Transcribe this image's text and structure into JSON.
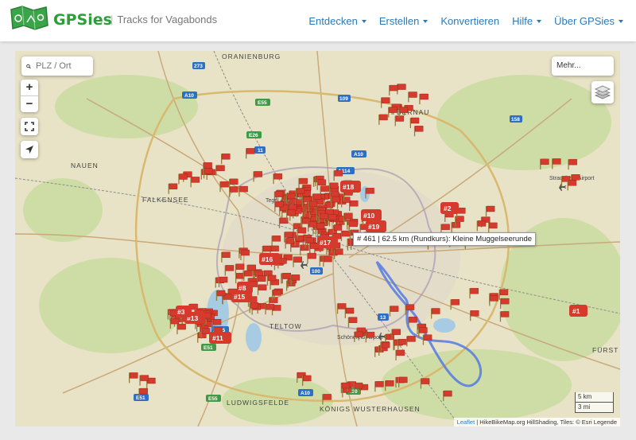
{
  "header": {
    "brand": "GPSies",
    "tagline": "Tracks for Vagabonds",
    "menu": [
      {
        "label": "Entdecken",
        "dropdown": true
      },
      {
        "label": "Erstellen",
        "dropdown": true
      },
      {
        "label": "Konvertieren",
        "dropdown": false
      },
      {
        "label": "Hilfe",
        "dropdown": true
      },
      {
        "label": "Über GPSies",
        "dropdown": true
      }
    ]
  },
  "map": {
    "search_placeholder": "PLZ / Ort",
    "zoom_in": "+",
    "zoom_out": "−",
    "more_label": "Mehr...",
    "tooltip": "# 461 | 62.5 km (Rundkurs): Kleine Muggelseerunde",
    "scale_km": "5 km",
    "scale_mi": "3 mi",
    "attribution_leaflet": "Leaflet",
    "attribution_rest": " | HikeBikeMap.org HillShading, Tiles: © Esri Legende",
    "places": [
      "ORANIENBURG",
      "NAUEN",
      "FALKENSEE",
      "TELTOW",
      "LUDWIGSFELDE",
      "KÖNIGS WUSTERHAUSEN",
      "FÜRST",
      "Strausberg Airport",
      "Tegel Airport",
      "Schönefeld Airport",
      "BERNAU"
    ],
    "highways": [
      "273",
      "A10",
      "E55",
      "109",
      "158",
      "E26",
      "11",
      "A114",
      "A10",
      "A115",
      "E51",
      "A10",
      "E30",
      "E55",
      "E51",
      "13",
      "100"
    ],
    "numbered_markers": [
      "#1",
      "#2",
      "#10",
      "#11",
      "#13",
      "#15",
      "#16",
      "#17",
      "#18",
      "#19",
      "#3",
      "#8"
    ],
    "colors": {
      "marker": "#d63a2c",
      "route": "#5b7fe0",
      "highway_blue": "#2e6fc4",
      "highway_green": "#3f9a47",
      "brand": "#2e9e3b",
      "link": "#2a7ab9"
    }
  }
}
